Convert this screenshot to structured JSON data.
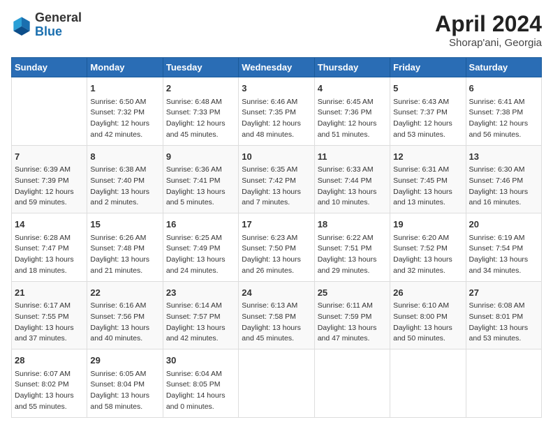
{
  "header": {
    "logo_general": "General",
    "logo_blue": "Blue",
    "month_title": "April 2024",
    "location": "Shorap'ani, Georgia"
  },
  "days_of_week": [
    "Sunday",
    "Monday",
    "Tuesday",
    "Wednesday",
    "Thursday",
    "Friday",
    "Saturday"
  ],
  "weeks": [
    [
      {
        "day": "",
        "info": ""
      },
      {
        "day": "1",
        "info": "Sunrise: 6:50 AM\nSunset: 7:32 PM\nDaylight: 12 hours\nand 42 minutes."
      },
      {
        "day": "2",
        "info": "Sunrise: 6:48 AM\nSunset: 7:33 PM\nDaylight: 12 hours\nand 45 minutes."
      },
      {
        "day": "3",
        "info": "Sunrise: 6:46 AM\nSunset: 7:35 PM\nDaylight: 12 hours\nand 48 minutes."
      },
      {
        "day": "4",
        "info": "Sunrise: 6:45 AM\nSunset: 7:36 PM\nDaylight: 12 hours\nand 51 minutes."
      },
      {
        "day": "5",
        "info": "Sunrise: 6:43 AM\nSunset: 7:37 PM\nDaylight: 12 hours\nand 53 minutes."
      },
      {
        "day": "6",
        "info": "Sunrise: 6:41 AM\nSunset: 7:38 PM\nDaylight: 12 hours\nand 56 minutes."
      }
    ],
    [
      {
        "day": "7",
        "info": "Sunrise: 6:39 AM\nSunset: 7:39 PM\nDaylight: 12 hours\nand 59 minutes."
      },
      {
        "day": "8",
        "info": "Sunrise: 6:38 AM\nSunset: 7:40 PM\nDaylight: 13 hours\nand 2 minutes."
      },
      {
        "day": "9",
        "info": "Sunrise: 6:36 AM\nSunset: 7:41 PM\nDaylight: 13 hours\nand 5 minutes."
      },
      {
        "day": "10",
        "info": "Sunrise: 6:35 AM\nSunset: 7:42 PM\nDaylight: 13 hours\nand 7 minutes."
      },
      {
        "day": "11",
        "info": "Sunrise: 6:33 AM\nSunset: 7:44 PM\nDaylight: 13 hours\nand 10 minutes."
      },
      {
        "day": "12",
        "info": "Sunrise: 6:31 AM\nSunset: 7:45 PM\nDaylight: 13 hours\nand 13 minutes."
      },
      {
        "day": "13",
        "info": "Sunrise: 6:30 AM\nSunset: 7:46 PM\nDaylight: 13 hours\nand 16 minutes."
      }
    ],
    [
      {
        "day": "14",
        "info": "Sunrise: 6:28 AM\nSunset: 7:47 PM\nDaylight: 13 hours\nand 18 minutes."
      },
      {
        "day": "15",
        "info": "Sunrise: 6:26 AM\nSunset: 7:48 PM\nDaylight: 13 hours\nand 21 minutes."
      },
      {
        "day": "16",
        "info": "Sunrise: 6:25 AM\nSunset: 7:49 PM\nDaylight: 13 hours\nand 24 minutes."
      },
      {
        "day": "17",
        "info": "Sunrise: 6:23 AM\nSunset: 7:50 PM\nDaylight: 13 hours\nand 26 minutes."
      },
      {
        "day": "18",
        "info": "Sunrise: 6:22 AM\nSunset: 7:51 PM\nDaylight: 13 hours\nand 29 minutes."
      },
      {
        "day": "19",
        "info": "Sunrise: 6:20 AM\nSunset: 7:52 PM\nDaylight: 13 hours\nand 32 minutes."
      },
      {
        "day": "20",
        "info": "Sunrise: 6:19 AM\nSunset: 7:54 PM\nDaylight: 13 hours\nand 34 minutes."
      }
    ],
    [
      {
        "day": "21",
        "info": "Sunrise: 6:17 AM\nSunset: 7:55 PM\nDaylight: 13 hours\nand 37 minutes."
      },
      {
        "day": "22",
        "info": "Sunrise: 6:16 AM\nSunset: 7:56 PM\nDaylight: 13 hours\nand 40 minutes."
      },
      {
        "day": "23",
        "info": "Sunrise: 6:14 AM\nSunset: 7:57 PM\nDaylight: 13 hours\nand 42 minutes."
      },
      {
        "day": "24",
        "info": "Sunrise: 6:13 AM\nSunset: 7:58 PM\nDaylight: 13 hours\nand 45 minutes."
      },
      {
        "day": "25",
        "info": "Sunrise: 6:11 AM\nSunset: 7:59 PM\nDaylight: 13 hours\nand 47 minutes."
      },
      {
        "day": "26",
        "info": "Sunrise: 6:10 AM\nSunset: 8:00 PM\nDaylight: 13 hours\nand 50 minutes."
      },
      {
        "day": "27",
        "info": "Sunrise: 6:08 AM\nSunset: 8:01 PM\nDaylight: 13 hours\nand 53 minutes."
      }
    ],
    [
      {
        "day": "28",
        "info": "Sunrise: 6:07 AM\nSunset: 8:02 PM\nDaylight: 13 hours\nand 55 minutes."
      },
      {
        "day": "29",
        "info": "Sunrise: 6:05 AM\nSunset: 8:04 PM\nDaylight: 13 hours\nand 58 minutes."
      },
      {
        "day": "30",
        "info": "Sunrise: 6:04 AM\nSunset: 8:05 PM\nDaylight: 14 hours\nand 0 minutes."
      },
      {
        "day": "",
        "info": ""
      },
      {
        "day": "",
        "info": ""
      },
      {
        "day": "",
        "info": ""
      },
      {
        "day": "",
        "info": ""
      }
    ]
  ]
}
